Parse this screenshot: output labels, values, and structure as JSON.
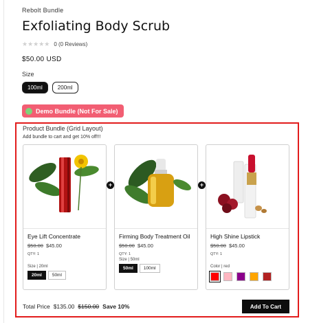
{
  "product": {
    "vendor": "Rebolt Bundle",
    "title": "Exfoliating Body Scrub",
    "rating_stars": "★★★★★",
    "rating_text": "0 (0 Reviews)",
    "price": "$50.00 USD",
    "size_label": "Size",
    "sizes": [
      "100ml",
      "200ml"
    ],
    "selected_size": "100ml",
    "demo_badge": "Demo Bundle (Not For Sale)"
  },
  "bundle": {
    "title": "Product Bundle (Grid Layout)",
    "subtitle": "Add bundle to cart and get 10% off!!!",
    "plus_symbol": "+",
    "items": [
      {
        "name": "Eye Lift Concentrate",
        "old_price": "$50.00",
        "price": "$45.00",
        "qty": "QTY: 1",
        "option_label": "Size",
        "option_value": "20ml",
        "options": [
          "20ml",
          "50ml"
        ],
        "selected": "20ml"
      },
      {
        "name": "Firming Body Treatment Oil",
        "old_price": "$50.00",
        "price": "$45.00",
        "qty": "QTY: 1",
        "option_label": "Size",
        "option_value": "50ml",
        "options": [
          "50ml",
          "100ml"
        ],
        "selected": "50ml"
      },
      {
        "name": "High Shine Lipstick",
        "old_price": "$50.00",
        "price": "$45.00",
        "qty": "QTY: 1",
        "option_label": "Color",
        "option_value": "red",
        "swatches": [
          "#ff0000",
          "#ffb6c1",
          "#8b008b",
          "#ffa500",
          "#b22222"
        ]
      }
    ],
    "total_label": "Total Price",
    "total_price": "$135.00",
    "total_old": "$150.00",
    "save_text": "Save 10%",
    "add_to_cart": "Add To Cart"
  },
  "colors": {
    "accent_border": "#e21b1b",
    "demo_badge_bg": "#f25e73",
    "dark": "#111111"
  }
}
